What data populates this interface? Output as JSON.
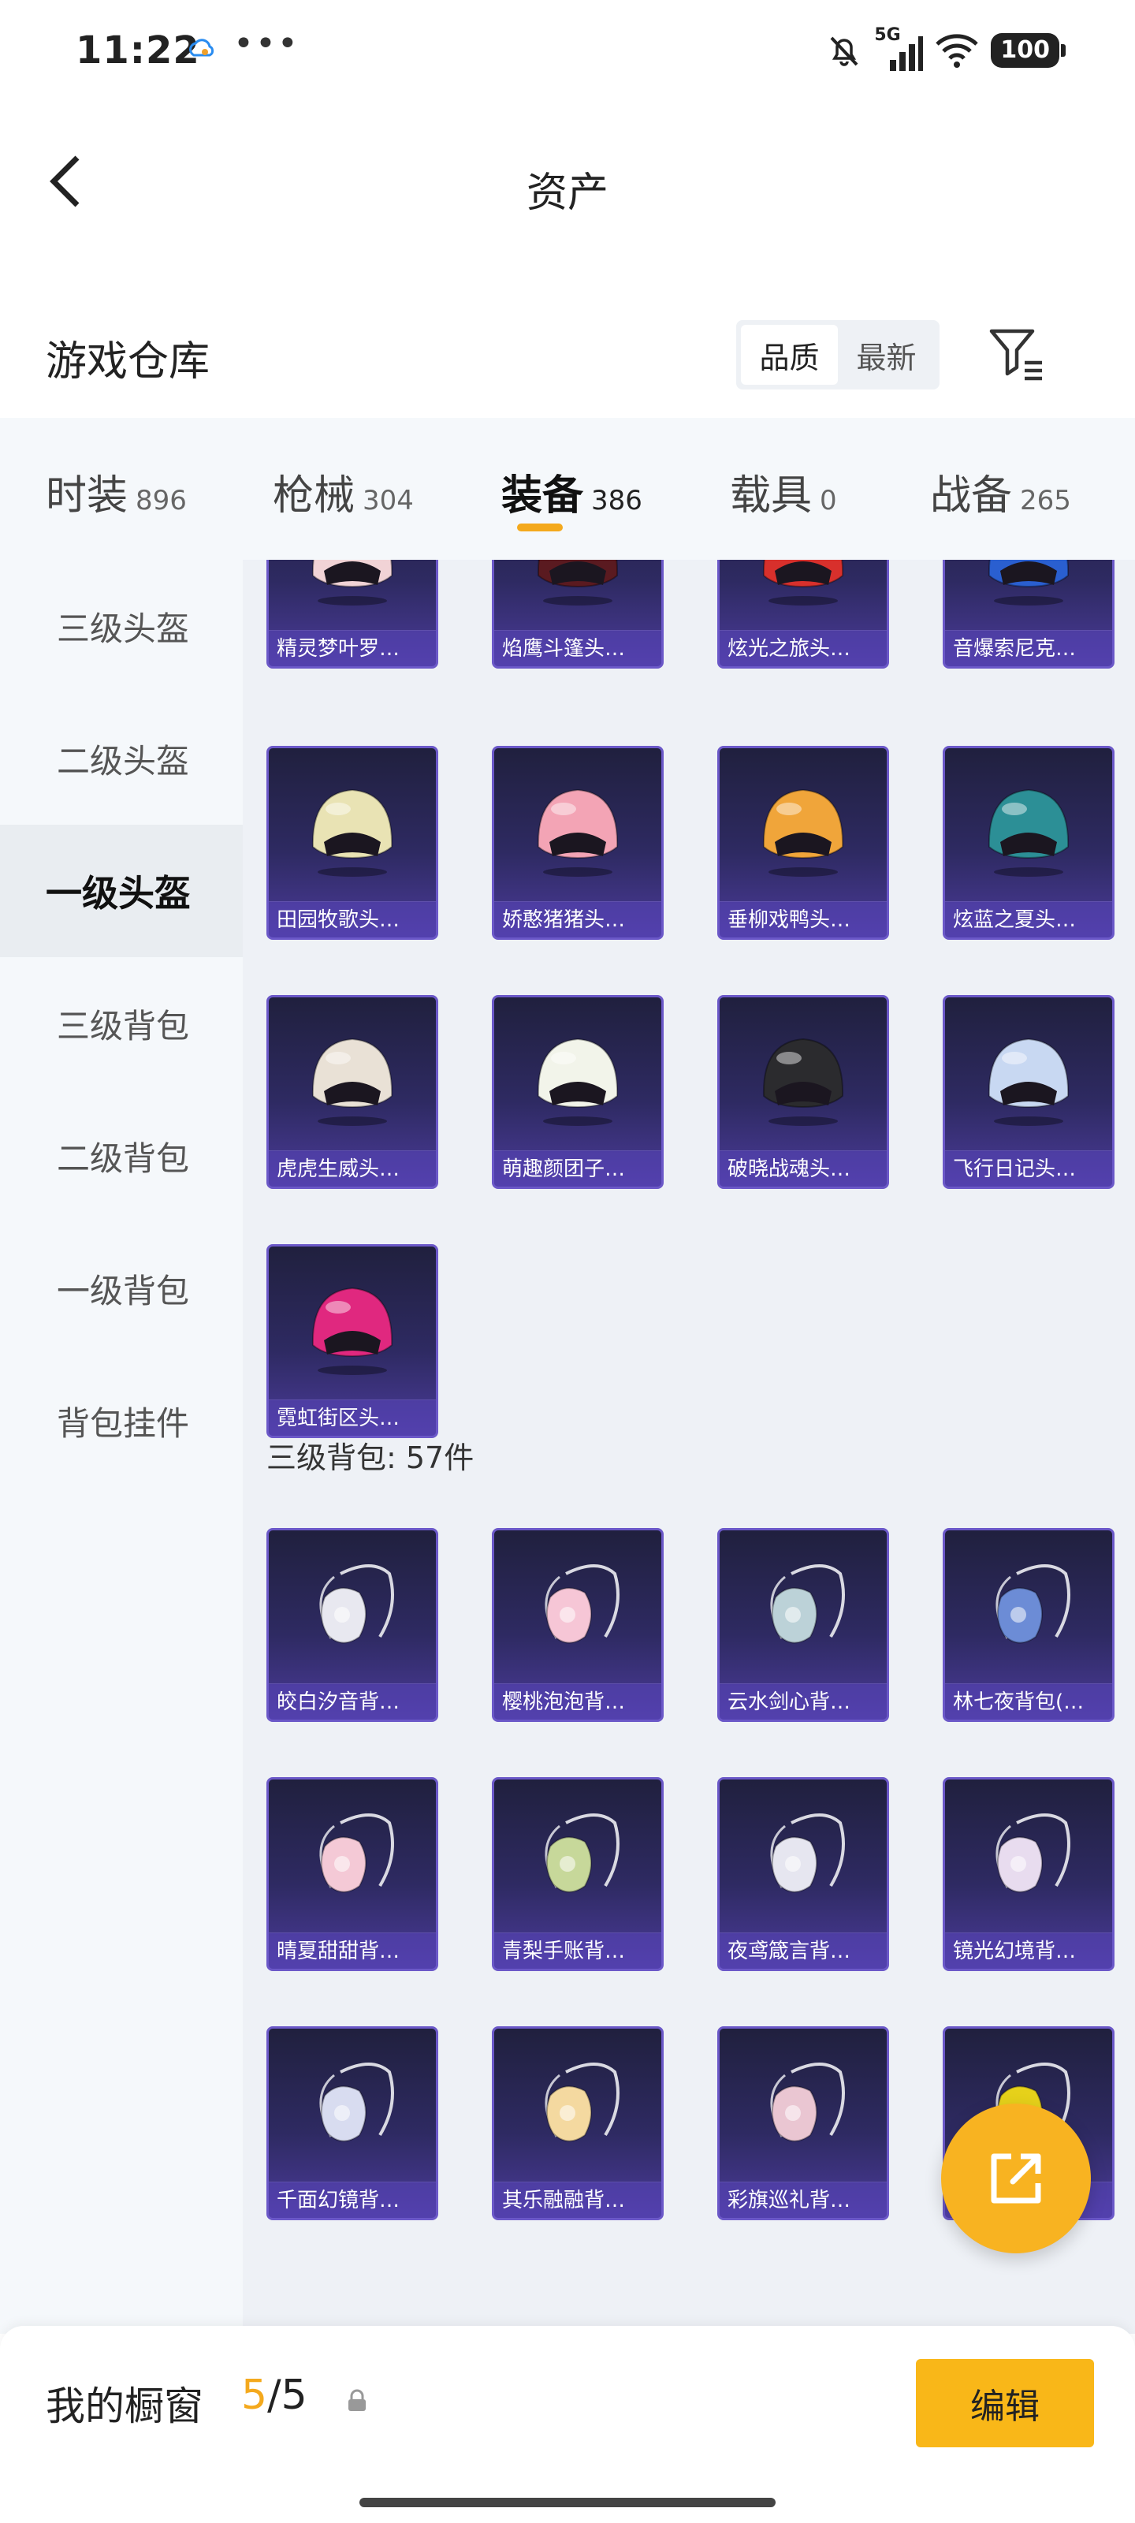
{
  "status": {
    "time": "11:22",
    "signal_label": "5G",
    "battery": "100",
    "icons": [
      "cloud-sync-icon",
      "more-dots-icon",
      "mute-bell-icon",
      "signal-icon",
      "wifi-icon",
      "battery-icon"
    ]
  },
  "header": {
    "title": "资产",
    "back_icon": "chevron-left-icon"
  },
  "warehouse": {
    "title": "游戏仓库",
    "sort_options": [
      "品质",
      "最新"
    ],
    "sort_selected": "品质",
    "filter_icon": "filter-icon"
  },
  "categories": [
    {
      "label": "时装",
      "count": "896"
    },
    {
      "label": "枪械",
      "count": "304"
    },
    {
      "label": "装备",
      "count": "386",
      "active": true
    },
    {
      "label": "载具",
      "count": "0"
    },
    {
      "label": "战备",
      "count": "265"
    }
  ],
  "sidebar": [
    {
      "label": "三级头盔"
    },
    {
      "label": "二级头盔"
    },
    {
      "label": "一级头盔",
      "active": true
    },
    {
      "label": "三级背包"
    },
    {
      "label": "二级背包"
    },
    {
      "label": "一级背包"
    },
    {
      "label": "背包挂件"
    }
  ],
  "helmets": [
    {
      "name": "精灵梦叶罗…",
      "color": "#f1d3d6"
    },
    {
      "name": "焰鹰斗篷头…",
      "color": "#5a1a20"
    },
    {
      "name": "炫光之旅头…",
      "color": "#d8302c"
    },
    {
      "name": "音爆索尼克…",
      "color": "#2a5fd0"
    },
    {
      "name": "田园牧歌头…",
      "color": "#e9e3b4"
    },
    {
      "name": "娇憨猪猪头…",
      "color": "#f3a4b5"
    },
    {
      "name": "垂柳戏鸭头…",
      "color": "#f0a53a"
    },
    {
      "name": "炫蓝之夏头…",
      "color": "#2c8f96"
    },
    {
      "name": "虎虎生威头…",
      "color": "#e9e1d6"
    },
    {
      "name": "萌趣颜团子…",
      "color": "#f2f4ea"
    },
    {
      "name": "破晓战魂头…",
      "color": "#2b2b2e"
    },
    {
      "name": "飞行日记头…",
      "color": "#c8d8f2"
    },
    {
      "name": "霓虹街区头…",
      "color": "#e0287f"
    }
  ],
  "backpack_section": {
    "label": "三级背包: 57件"
  },
  "backpacks": [
    {
      "name": "皎白汐音背…",
      "color": "#e8e8f0"
    },
    {
      "name": "樱桃泡泡背…",
      "color": "#f6c6d6"
    },
    {
      "name": "云水剑心背…",
      "color": "#bcd2d8"
    },
    {
      "name": "林七夜背包(…",
      "color": "#6c8cd6"
    },
    {
      "name": "晴夏甜甜背…",
      "color": "#f4c9d6"
    },
    {
      "name": "青梨手账背…",
      "color": "#c7d89a"
    },
    {
      "name": "夜鸢箴言背…",
      "color": "#e6e6f0"
    },
    {
      "name": "镜光幻境背…",
      "color": "#e8dcef"
    },
    {
      "name": "千面幻镜背…",
      "color": "#d8dcf0"
    },
    {
      "name": "其乐融融背…",
      "color": "#f4d9a0"
    },
    {
      "name": "彩旗巡礼背…",
      "color": "#eac6d2"
    },
    {
      "name": "",
      "color": "#e6d11a"
    }
  ],
  "fab": {
    "icon": "share-external-icon"
  },
  "bottom": {
    "showcase_label": "我的橱窗",
    "showcase_current": "5",
    "showcase_total": "/5",
    "lock_icon": "lock-icon",
    "edit_label": "编辑"
  }
}
